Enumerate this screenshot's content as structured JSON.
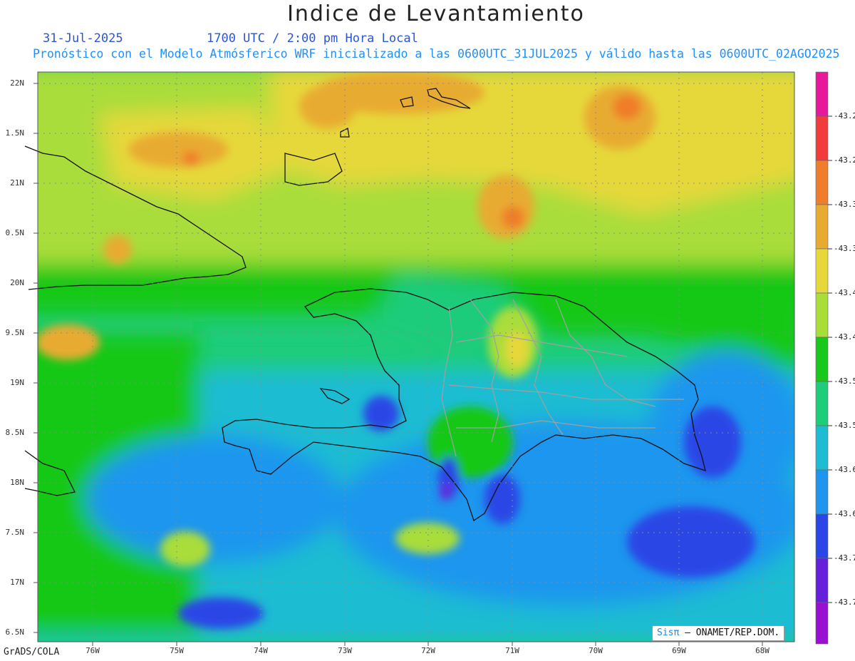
{
  "title": "Indice de Levantamiento",
  "date": "31-Jul-2025",
  "time": "1700 UTC / 2:00 pm Hora Local",
  "description": "Pronóstico con el Modelo Atmósferico WRF inicializado a las 0600UTC_31JUL2025 y válido hasta las  0600UTC_02AGO2025",
  "lat_labels": [
    "22N",
    "1.5N",
    "21N",
    "0.5N",
    "20N",
    "9.5N",
    "19N",
    "8.5N",
    "18N",
    "7.5N",
    "17N",
    "6.5N"
  ],
  "lon_labels": [
    "76W",
    "75W",
    "74W",
    "73W",
    "72W",
    "71W",
    "70W",
    "69W",
    "68W"
  ],
  "colorbar": {
    "labels": [
      "-43.2",
      "-43.2",
      "-43.3",
      "-43.3",
      "-43.4",
      "-43.4",
      "-43.5",
      "-43.5",
      "-43.6",
      "-43.6",
      "-43.7",
      "-43.7"
    ],
    "colors": [
      "#e8189a",
      "#f23c3c",
      "#ef7d2c",
      "#e8ab31",
      "#e6d83a",
      "#a9dd3a",
      "#19c819",
      "#1fcc7a",
      "#1ebcd2",
      "#1f96ee",
      "#2b46e6",
      "#6620dc",
      "#9a10d2"
    ]
  },
  "credit": {
    "sis": "Sisπ",
    "rest": "– ONAMET/REP.DOM."
  },
  "footer": "GrADS/COLA",
  "colors": {
    "sea_deep": "#2b46e6",
    "sea_blue": "#1f96ee",
    "sea_cyan": "#1ebcd2",
    "teal": "#1fcc7a",
    "green": "#19c819",
    "lime": "#a9dd3a",
    "yellow": "#e6d83a",
    "orange": "#e8ab31",
    "dark_orange": "#ef7d2c",
    "red": "#f23c3c",
    "purple": "#6620dc"
  }
}
